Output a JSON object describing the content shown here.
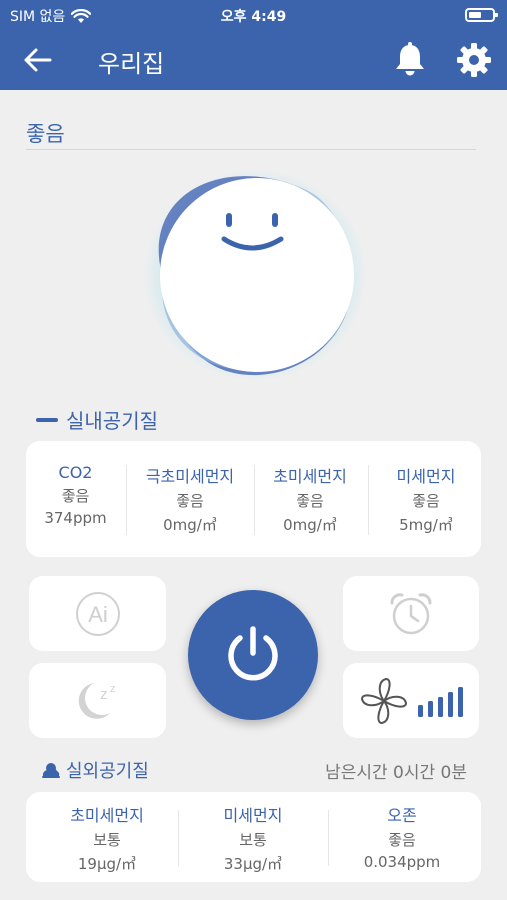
{
  "status_bar": {
    "carrier": "SIM 없음",
    "time": "오후 4:49"
  },
  "header": {
    "title": "우리집"
  },
  "air_status": {
    "label": "좋음",
    "face": "smiling-face"
  },
  "indoor": {
    "section_title": "실내공기질",
    "metrics": [
      {
        "name": "CO2",
        "status": "좋음",
        "value": "374ppm"
      },
      {
        "name": "극초미세먼지",
        "status": "좋음",
        "value": "0mg/㎥"
      },
      {
        "name": "초미세먼지",
        "status": "좋음",
        "value": "0mg/㎥"
      },
      {
        "name": "미세먼지",
        "status": "좋음",
        "value": "5mg/㎥"
      }
    ]
  },
  "controls": {
    "ai_label": "Ai",
    "icons": [
      "ai-icon",
      "alarm-clock-icon",
      "sleep-moon-icon",
      "fan-icon",
      "fan-level-icon",
      "power-icon"
    ],
    "fan_level_bars": 5
  },
  "outdoor": {
    "section_title": "실외공기질",
    "remaining_time": "남은시간 0시간 0분",
    "metrics": [
      {
        "name": "초미세먼지",
        "status": "보통",
        "value": "19μg/㎥"
      },
      {
        "name": "미세먼지",
        "status": "보통",
        "value": "33μg/㎥"
      },
      {
        "name": "오존",
        "status": "좋음",
        "value": "0.034ppm"
      }
    ]
  },
  "colors": {
    "primary": "#3b64ad",
    "background": "#efefef",
    "inactive_icon": "#d0d0d0"
  }
}
